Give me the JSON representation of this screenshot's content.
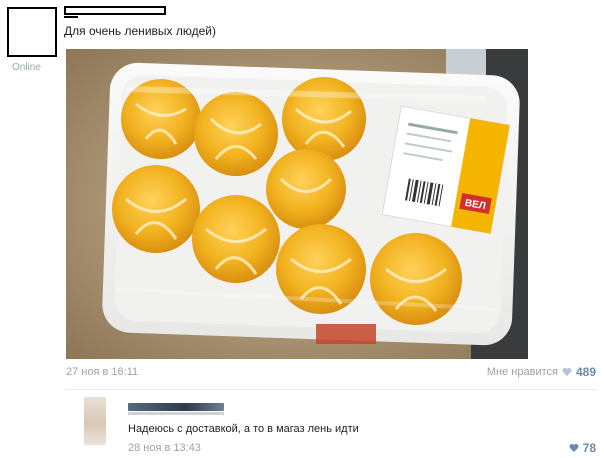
{
  "post": {
    "online_label": "Online",
    "text": "Для очень ленивых людей)",
    "date": "27 ноя в 16:11",
    "like_label": "Мне нравится",
    "like_count": "489",
    "image_label_text": "ВЕЛ"
  },
  "comment": {
    "text": "Надеюсь с доставкой, а то в магаз лень идти",
    "date": "28 ноя в 13:43",
    "like_count": "78"
  },
  "colors": {
    "meta_gray": "#98a2ae",
    "like_blue": "#6b8aaa",
    "heart": "#b7c3d0"
  }
}
